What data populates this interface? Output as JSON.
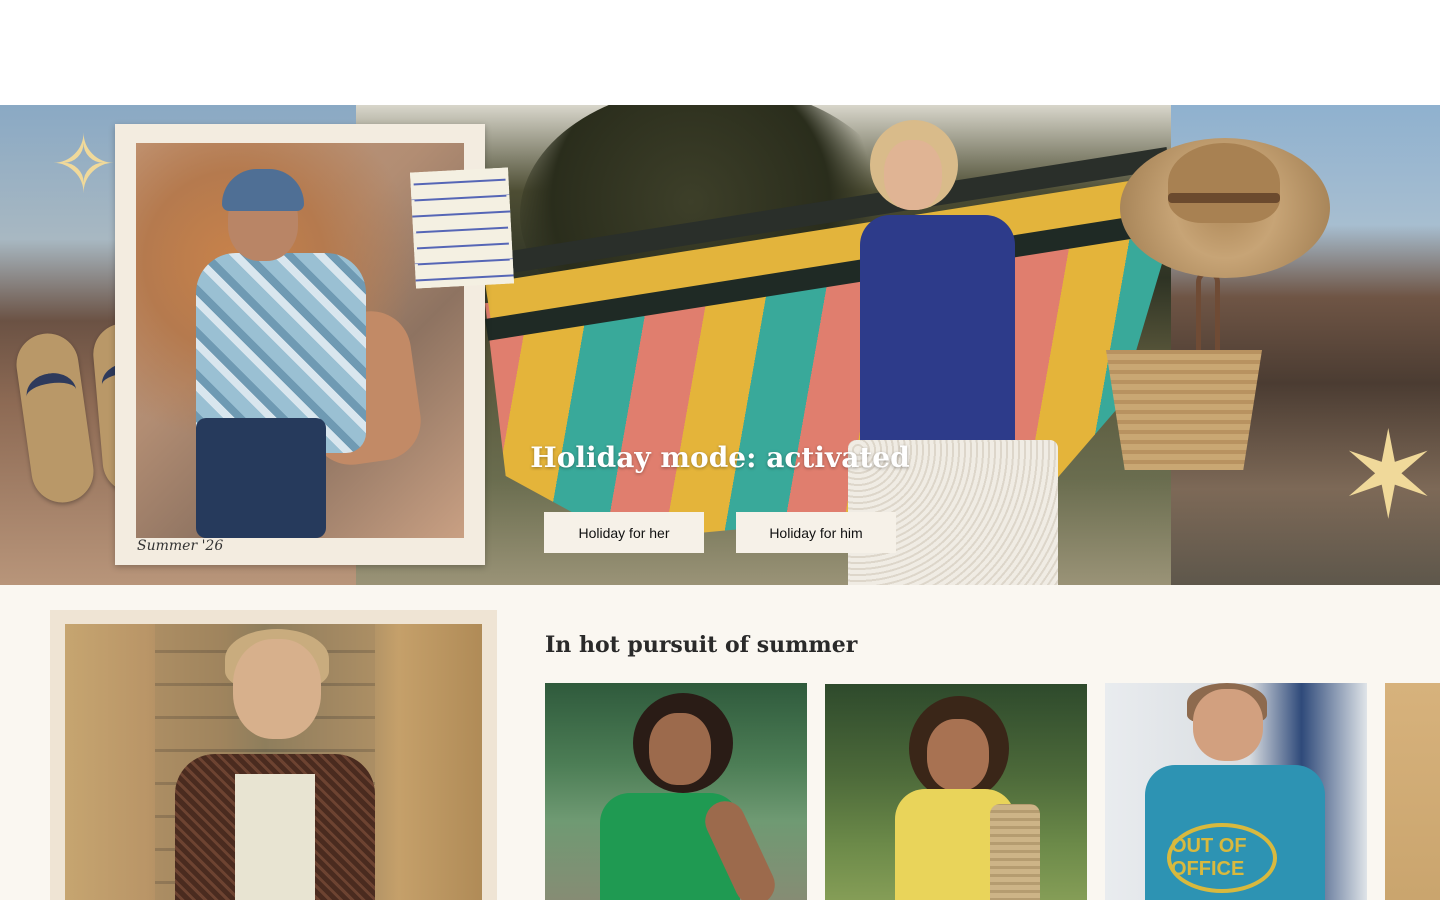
{
  "hero": {
    "title": "Holiday mode: activated",
    "buttons": {
      "her": "Holiday for her",
      "him": "Holiday for him"
    },
    "polaroid_caption": "Summer '26"
  },
  "section": {
    "title": "In hot pursuit of summer",
    "product_tiles": [
      {
        "name": "product-tile-green-top"
      },
      {
        "name": "product-tile-yellow-shirt"
      },
      {
        "name": "product-tile-blue-tee"
      },
      {
        "name": "product-tile-partial"
      }
    ],
    "tee_print": "OUT OF OFFICE"
  },
  "colors": {
    "page_bg": "#ffffff",
    "lower_bg": "#faf7f1",
    "button_bg": "#f6f1e8",
    "hero_text": "#ffffff"
  }
}
